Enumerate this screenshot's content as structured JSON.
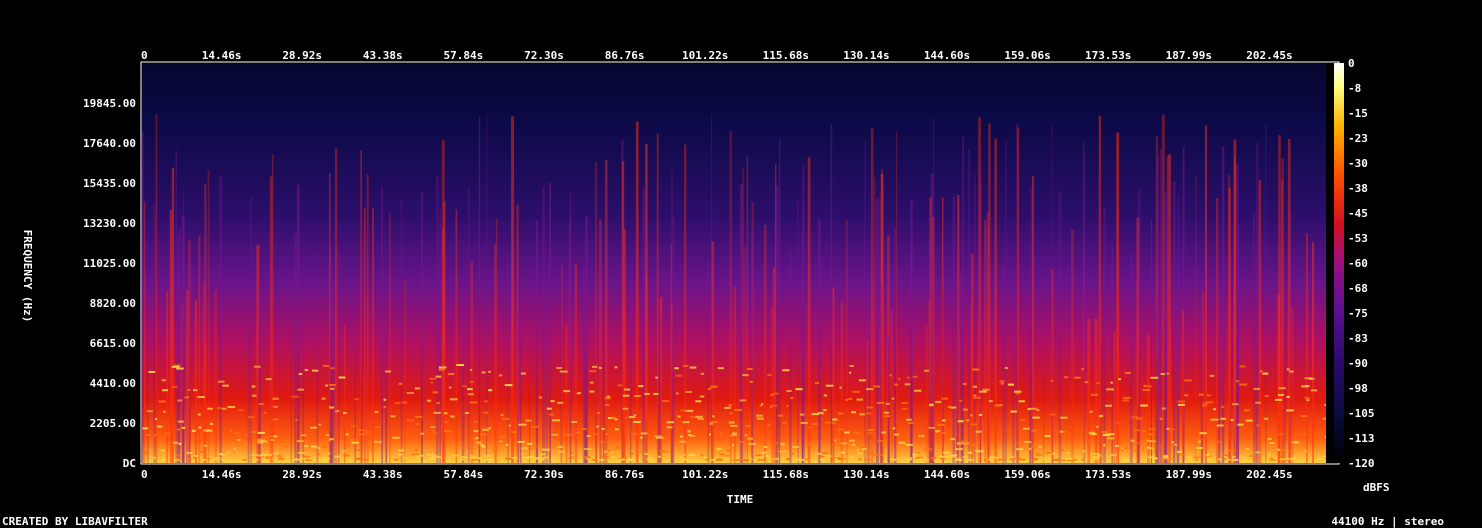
{
  "chart_data": {
    "type": "heatmap",
    "title": "",
    "xlabel": "TIME",
    "ylabel": "FREQUENCY (Hz)",
    "x_ticks": [
      "0",
      "14.46s",
      "28.92s",
      "43.38s",
      "57.84s",
      "72.30s",
      "86.76s",
      "101.22s",
      "115.68s",
      "130.14s",
      "144.60s",
      "159.06s",
      "173.53s",
      "187.99s",
      "202.45s"
    ],
    "x_range": [
      0,
      216.9
    ],
    "y_ticks": [
      "DC",
      "2205.00",
      "4410.00",
      "6615.00",
      "8820.00",
      "11025.00",
      "13230.00",
      "15435.00",
      "17640.00",
      "19845.00"
    ],
    "y_range": [
      0,
      22050
    ],
    "colorbar": {
      "label": "dBFS",
      "ticks": [
        "0",
        "-8",
        "-15",
        "-23",
        "-30",
        "-38",
        "-45",
        "-53",
        "-60",
        "-68",
        "-75",
        "-83",
        "-90",
        "-98",
        "-105",
        "-113",
        "-120"
      ],
      "range": [
        -120,
        0
      ],
      "colors": [
        "#000000",
        "#0a0a40",
        "#2a0a6a",
        "#5a1090",
        "#9a1080",
        "#d41020",
        "#ff5000",
        "#ffb000",
        "#ffff80",
        "#ffffff"
      ]
    }
  },
  "footer": {
    "left": "CREATED BY LIBAVFILTER",
    "right": "44100 Hz | stereo"
  }
}
